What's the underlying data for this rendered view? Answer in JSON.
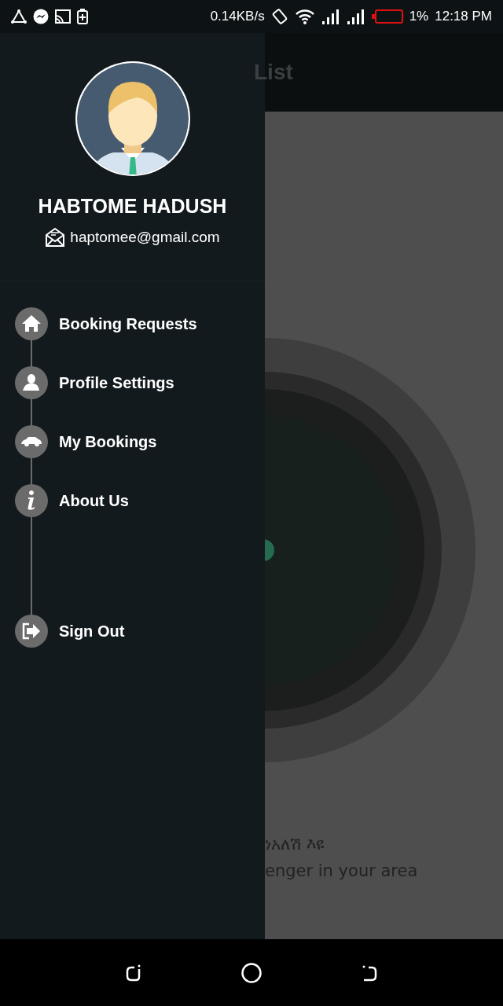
{
  "status_bar": {
    "speed": "0.14KB/s",
    "battery": "1%",
    "time": "12:18 PM"
  },
  "background": {
    "app_bar_title": "List",
    "messages": [
      "ነአለሽ እዩ",
      "enger in your area"
    ]
  },
  "drawer": {
    "name": "HABTOME HADUSH",
    "email": "haptomee@gmail.com",
    "items": [
      {
        "label": "Booking Requests",
        "kind": "link"
      },
      {
        "label": "Profile Settings",
        "kind": "link"
      },
      {
        "label": "My Bookings",
        "kind": "link"
      },
      {
        "label": "About Us",
        "kind": "link"
      },
      {
        "label": "Sign Out",
        "kind": "signout"
      }
    ]
  }
}
